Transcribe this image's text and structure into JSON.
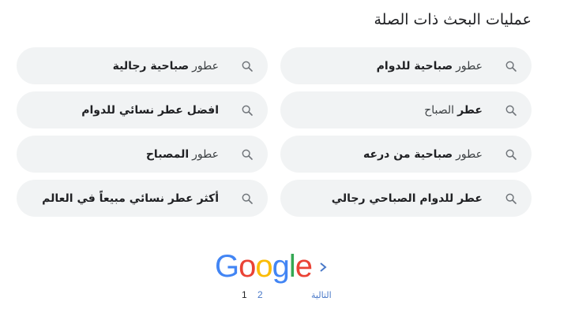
{
  "section_title": "عمليات البحث ذات الصلة",
  "related_searches": [
    {
      "prefix": "عطور",
      "bold": "صباحية للدوام",
      "suffix": ""
    },
    {
      "prefix": "عطور",
      "bold": "صباحية رجالية",
      "suffix": ""
    },
    {
      "prefix": "",
      "bold": "عطر",
      "suffix": "الصباح"
    },
    {
      "prefix": "",
      "bold": "افضل عطر نسائي للدوام",
      "suffix": ""
    },
    {
      "prefix": "عطور",
      "bold": "صباحية من درعه",
      "suffix": ""
    },
    {
      "prefix": "عطور",
      "bold": "المصباح",
      "suffix": ""
    },
    {
      "prefix": "",
      "bold": "عطر للدوام الصباحي رجالي",
      "suffix": ""
    },
    {
      "prefix": "",
      "bold": "أكثر عطر نسائي مبيعاً في العالم",
      "suffix": ""
    }
  ],
  "pagination": {
    "logo_letters": [
      "G",
      "o",
      "o",
      "g",
      "l",
      "e"
    ],
    "logo_colors": [
      "#4285f4",
      "#ea4335",
      "#fbbc05",
      "#4285f4",
      "#34a853",
      "#ea4335"
    ],
    "current_page": "1",
    "next_page": "2",
    "next_label": "التالية",
    "next_icon": "chevron-right-icon"
  },
  "colors": {
    "chip_bg": "#f1f3f4",
    "link": "#4a79c8",
    "text": "#202124"
  }
}
